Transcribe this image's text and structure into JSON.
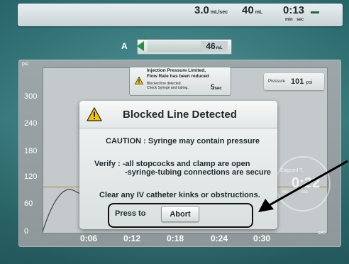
{
  "status": {
    "flow_rate": "3.0",
    "flow_rate_unit": "mL/sec",
    "volume": "40",
    "volume_unit": "mL",
    "time": "0:13",
    "time_min": "min",
    "time_sec": "sec"
  },
  "syringe": {
    "label": "A",
    "volume": "46",
    "volume_unit": "mL",
    "fill_fraction": 0.65
  },
  "chart": {
    "y_unit": "psi",
    "x_unit": "sec",
    "yticks": [
      "0",
      "60",
      "120",
      "180",
      "240",
      "300"
    ],
    "xticks": [
      "0:06",
      "0:12",
      "0:18",
      "0:24",
      "0:30"
    ]
  },
  "pressure": {
    "label": "Pressure",
    "value": "101",
    "unit": "psi"
  },
  "elapsed": {
    "label": "Elapsed T.",
    "value": "0:22",
    "min": "min",
    "sec": "sec"
  },
  "toast": {
    "title_line1": "Injection Pressure Limited,",
    "title_line2": "Flow Rate has been reduced",
    "body_line1": "Blocked line detected.",
    "body_line2": "Check Syringe and tubing.",
    "time": "5",
    "time_unit": "sec"
  },
  "dialog": {
    "title": "Blocked Line Detected",
    "caution": "CAUTION : Syringe may contain pressure",
    "verify_line1": "Verify : -all stopcocks and clamp are open",
    "verify_line2": "-syringe-tubing connections are secure",
    "clear": "Clear any IV catheter kinks or obstructions.",
    "press_to": "Press to",
    "abort": "Abort"
  },
  "colors": {
    "background": "#3f8d8f",
    "accent_green": "#2e8a4c",
    "warning_yellow": "#f5c400",
    "limit_line": "#b6872a"
  },
  "icons": {
    "warning": "warning-triangle-icon",
    "arrow": "annotation-arrow"
  }
}
